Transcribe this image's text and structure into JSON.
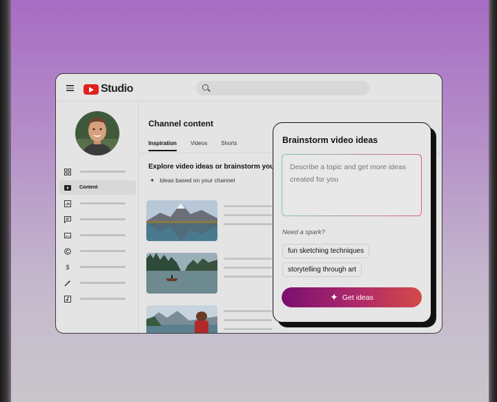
{
  "app": {
    "logo_text": "Studio"
  },
  "sidebar": {
    "items": [
      {
        "icon": "dashboard-icon",
        "label": ""
      },
      {
        "icon": "content-icon",
        "label": "Content"
      },
      {
        "icon": "analytics-icon",
        "label": ""
      },
      {
        "icon": "comments-icon",
        "label": ""
      },
      {
        "icon": "subtitles-icon",
        "label": ""
      },
      {
        "icon": "copyright-icon",
        "label": ""
      },
      {
        "icon": "earn-icon",
        "label": ""
      },
      {
        "icon": "customization-icon",
        "label": ""
      },
      {
        "icon": "audio-library-icon",
        "label": ""
      }
    ]
  },
  "main": {
    "title": "Channel content",
    "tabs": [
      "Inspiration",
      "Videos",
      "Shorts"
    ],
    "active_tab": "Inspiration",
    "explore_heading": "Explore video ideas or brainstorm you",
    "based_on": "Ideas based on your channel"
  },
  "brainstorm": {
    "title": "Brainstorm video ideas",
    "placeholder": "Describe a topic and get more ideas created for you",
    "spark_label": "Need a spark?",
    "suggestions": [
      "fun sketching techniques",
      "storytelling through art"
    ],
    "button_label": "Get ideas"
  },
  "colors": {
    "accent_red": "#e02020",
    "button_start": "#7a1070",
    "button_end": "#d24a48"
  }
}
